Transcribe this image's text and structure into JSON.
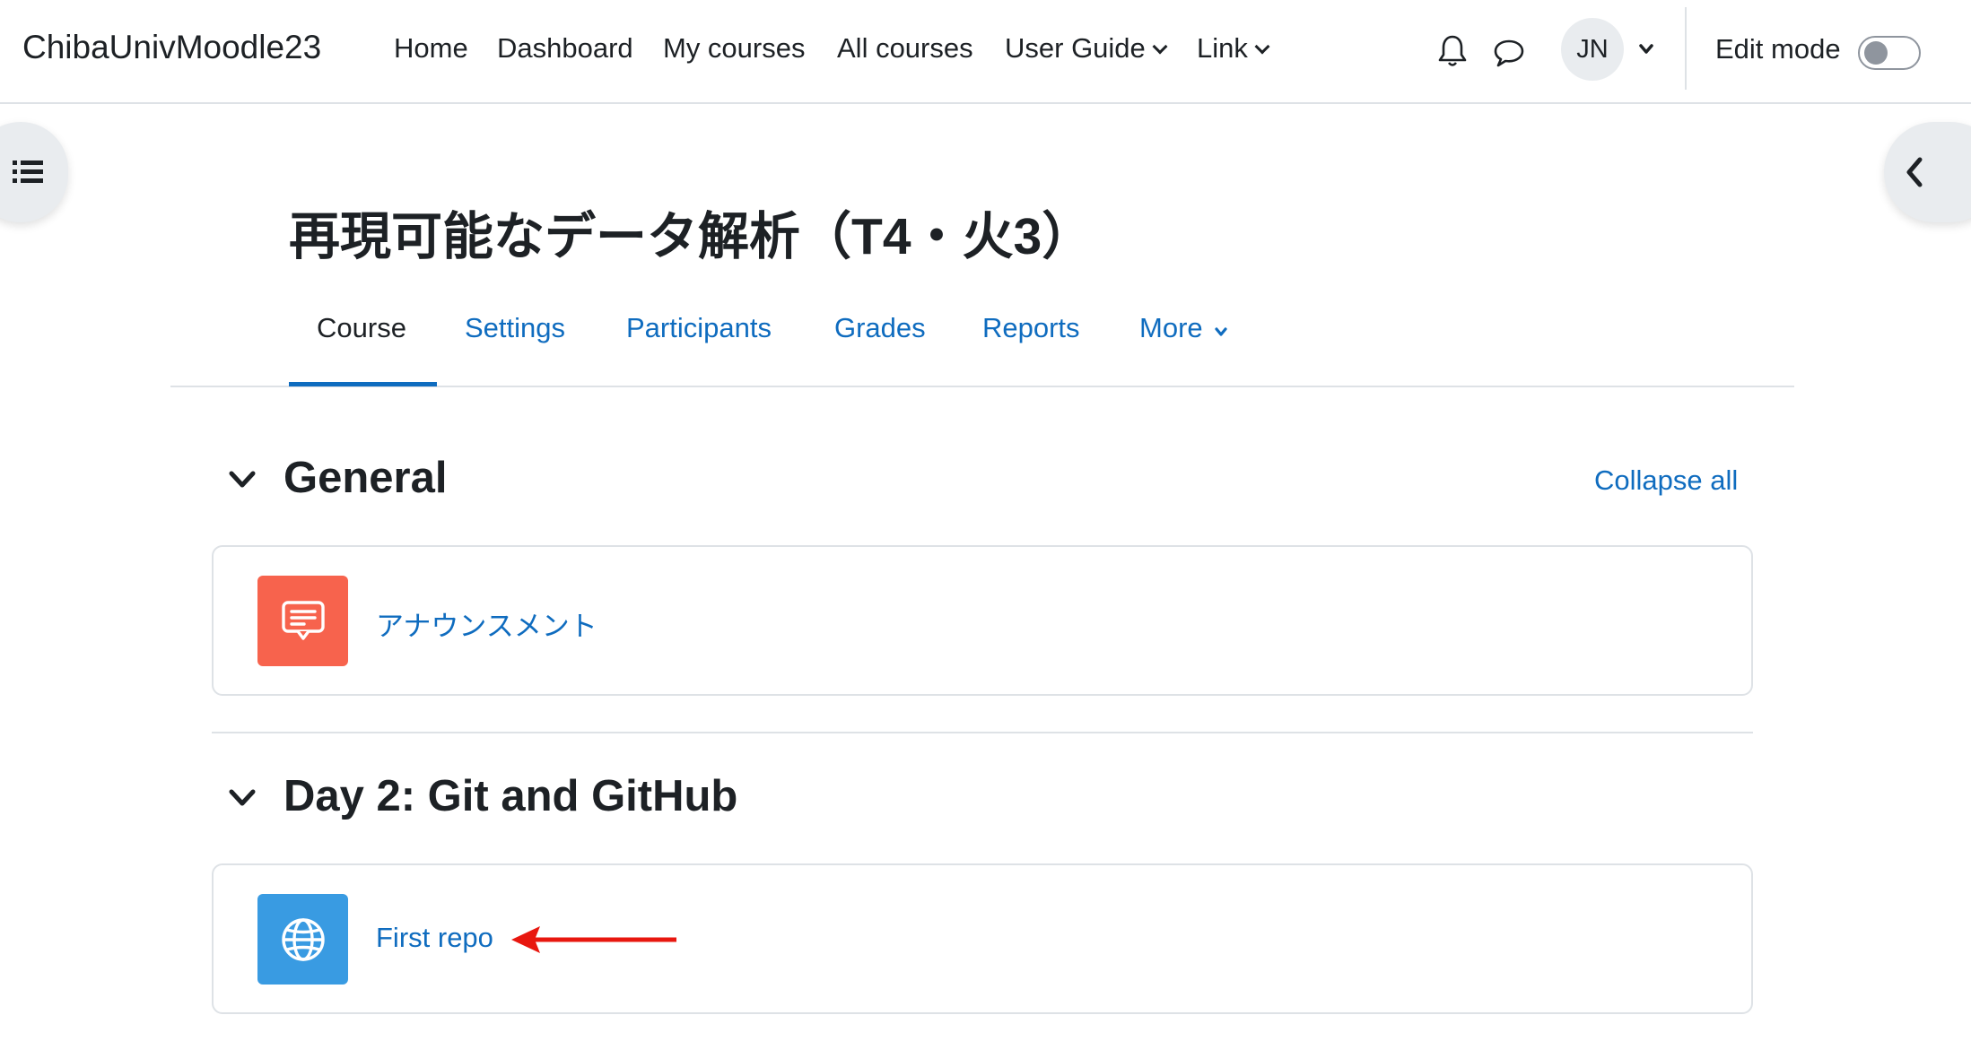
{
  "navbar": {
    "brand": "ChibaUnivMoodle23",
    "items": [
      {
        "label": "Home"
      },
      {
        "label": "Dashboard"
      },
      {
        "label": "My courses"
      },
      {
        "label": "All courses"
      },
      {
        "label": "User Guide"
      },
      {
        "label": "Link"
      }
    ],
    "icons": [
      "bell-icon",
      "chat-bubble-icon"
    ],
    "user_initials": "JN",
    "edit_mode_label": "Edit mode",
    "edit_mode_on": false
  },
  "course": {
    "title": "再現可能なデータ解析（T4・火3）",
    "tabs": [
      {
        "label": "Course",
        "active": true
      },
      {
        "label": "Settings"
      },
      {
        "label": "Participants"
      },
      {
        "label": "Grades"
      },
      {
        "label": "Reports"
      },
      {
        "label": "More"
      }
    ],
    "collapse_all_label": "Collapse all"
  },
  "sections": [
    {
      "title": "General",
      "activities": [
        {
          "name": "アナウンスメント",
          "icon": "forum-icon",
          "color": "#f7634d"
        }
      ]
    },
    {
      "title": "Day 2: Git and GitHub",
      "activities": [
        {
          "name": "First repo",
          "icon": "globe-icon",
          "color": "#399be2"
        }
      ]
    }
  ],
  "colors": {
    "link": "#0f6cbf",
    "text": "#1d2125",
    "annotation_arrow": "#e8170f"
  }
}
